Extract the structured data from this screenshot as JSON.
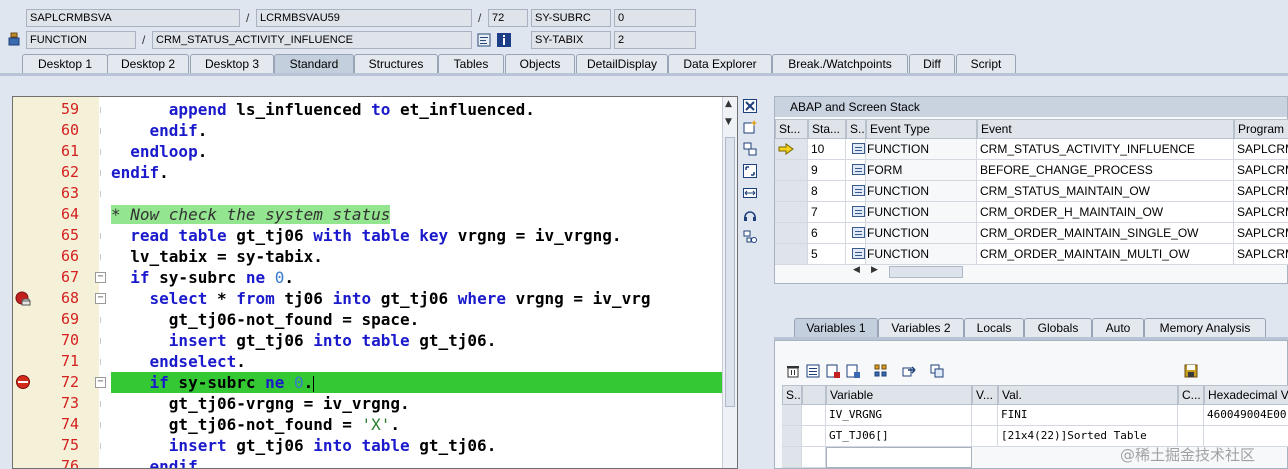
{
  "header": {
    "program": "SAPLCRMBSVA",
    "include": "LCRMBSVAU59",
    "line": "72",
    "sy_field1_name": "SY-SUBRC",
    "sy_field1_value": "0",
    "event_type": "FUNCTION",
    "event_name": "CRM_STATUS_ACTIVITY_INFLUENCE",
    "sy_field2_name": "SY-TABIX",
    "sy_field2_value": "2"
  },
  "tabs": [
    "Desktop 1",
    "Desktop 2",
    "Desktop 3",
    "Standard",
    "Structures",
    "Tables",
    "Objects",
    "DetailDisplay",
    "Data Explorer",
    "Break./Watchpoints",
    "Diff",
    "Script"
  ],
  "active_tab": "Standard",
  "code": {
    "lines": [
      {
        "num": "59",
        "text": "      append ls_influenced to et_influenced."
      },
      {
        "num": "60",
        "text": "    endif."
      },
      {
        "num": "61",
        "text": "  endloop."
      },
      {
        "num": "62",
        "text": "endif."
      },
      {
        "num": "63",
        "text": ""
      },
      {
        "num": "64",
        "text": "* Now check the system status"
      },
      {
        "num": "65",
        "text": "read table gt_tj06 with table key vrgng = iv_vrgng."
      },
      {
        "num": "66",
        "text": "lv_tabix = sy-tabix."
      },
      {
        "num": "67",
        "text": "if sy-subrc ne 0."
      },
      {
        "num": "68",
        "text": "  select * from tj06 into gt_tj06 where vrgng = iv_vrg"
      },
      {
        "num": "69",
        "text": "    gt_tj06-not_found = space."
      },
      {
        "num": "70",
        "text": "    insert gt_tj06 into table gt_tj06."
      },
      {
        "num": "71",
        "text": "  endselect."
      },
      {
        "num": "72",
        "text": "  if sy-subrc ne 0."
      },
      {
        "num": "73",
        "text": "    gt_tj06-vrgng = iv_vrgng."
      },
      {
        "num": "74",
        "text": "    gt_tj06-not_found = 'X'."
      },
      {
        "num": "75",
        "text": "    insert gt_tj06 into table gt_tj06."
      },
      {
        "num": "76",
        "text": "  endif."
      }
    ]
  },
  "stack": {
    "title": "ABAP and Screen Stack",
    "columns": [
      "St...",
      "Sta...",
      "S...",
      "Event Type",
      "Event",
      "Program"
    ],
    "rows": [
      {
        "level": "10",
        "type": "FUNCTION",
        "event": "CRM_STATUS_ACTIVITY_INFLUENCE",
        "program": "SAPLCRMB"
      },
      {
        "level": "9",
        "type": "FORM",
        "event": "BEFORE_CHANGE_PROCESS",
        "program": "SAPLCRM_"
      },
      {
        "level": "8",
        "type": "FUNCTION",
        "event": "CRM_STATUS_MAINTAIN_OW",
        "program": "SAPLCRM_"
      },
      {
        "level": "7",
        "type": "FUNCTION",
        "event": "CRM_ORDER_H_MAINTAIN_OW",
        "program": "SAPLCRM_"
      },
      {
        "level": "6",
        "type": "FUNCTION",
        "event": "CRM_ORDER_MAINTAIN_SINGLE_OW",
        "program": "SAPLCRM_"
      },
      {
        "level": "5",
        "type": "FUNCTION",
        "event": "CRM_ORDER_MAINTAIN_MULTI_OW",
        "program": "SAPLCRM_"
      }
    ]
  },
  "variables": {
    "tabs": [
      "Variables 1",
      "Variables 2",
      "Locals",
      "Globals",
      "Auto",
      "Memory Analysis"
    ],
    "active_tab": "Variables 1",
    "columns": [
      "S...",
      "Variable",
      "V...",
      "Val.",
      "C...",
      "Hexadecimal Va"
    ],
    "rows": [
      {
        "variable": "IV_VRGNG",
        "value": "FINI",
        "hex": "460049004E00"
      },
      {
        "variable": "GT_TJ06[]",
        "value": "[21x4(22)]Sorted Table",
        "hex": ""
      }
    ]
  },
  "watermark": "@稀土掘金技术社区"
}
